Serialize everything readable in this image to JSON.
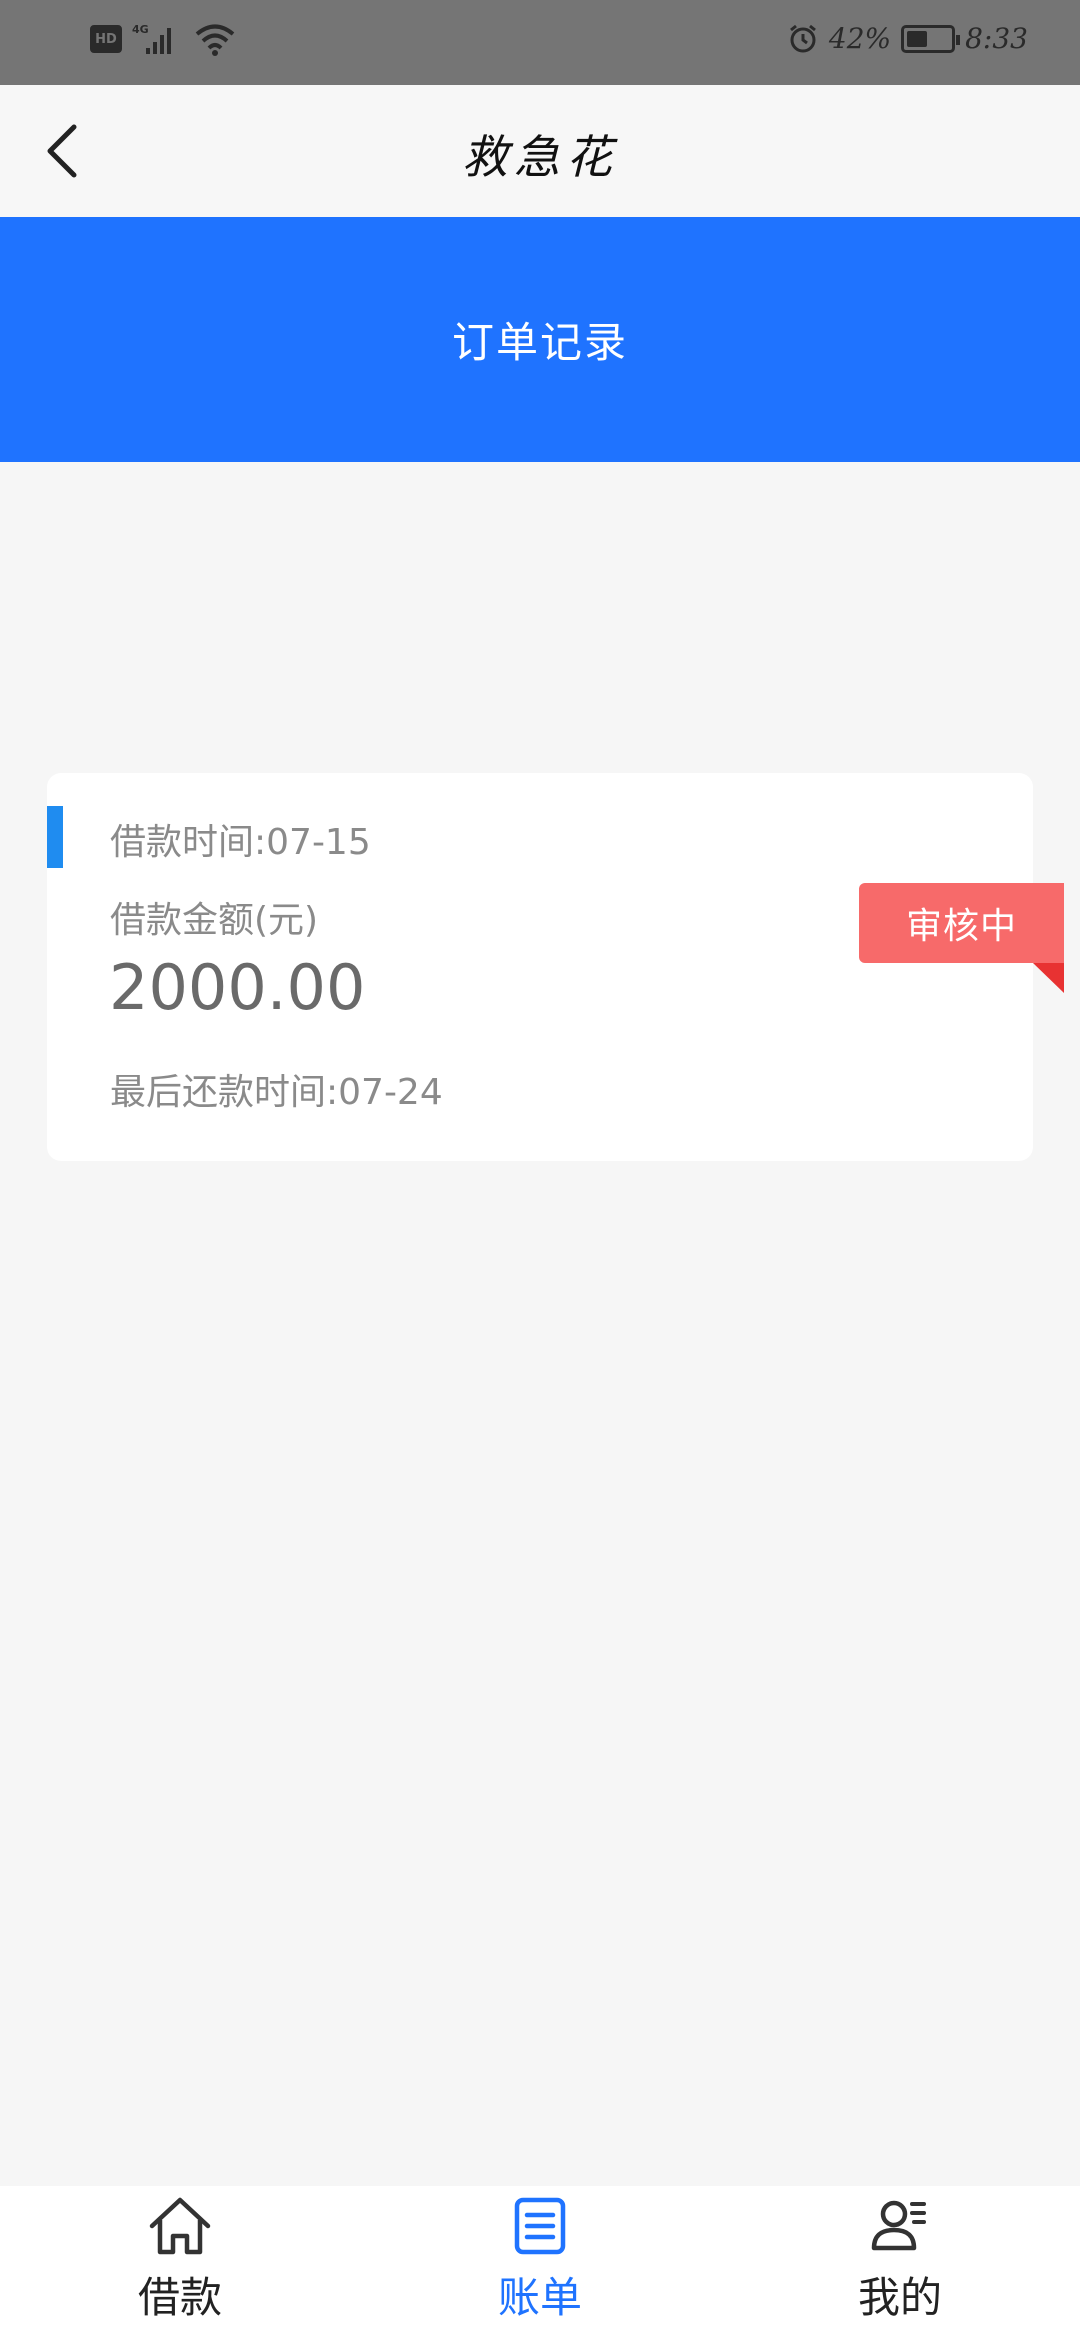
{
  "status_bar": {
    "hd": "HD",
    "network": "4G",
    "battery_percent": "42%",
    "battery_level": 0.42,
    "time": "8:33"
  },
  "header": {
    "title": "救急花",
    "back_icon": "chevron-left-icon"
  },
  "banner": {
    "title": "订单记录",
    "color": "#1f73ff"
  },
  "order": {
    "loan_date": "借款时间:07-15",
    "amount_label": "借款金额(元)",
    "amount": "2000.00",
    "due_date": "最后还款时间:07-24",
    "status": "审核中",
    "status_color": "#f76a6a"
  },
  "bottom_nav": {
    "items": [
      {
        "label": "借款",
        "icon": "home-icon",
        "active": false
      },
      {
        "label": "账单",
        "icon": "bill-icon",
        "active": true
      },
      {
        "label": "我的",
        "icon": "user-icon",
        "active": false
      }
    ],
    "active_color": "#1f73ff"
  }
}
